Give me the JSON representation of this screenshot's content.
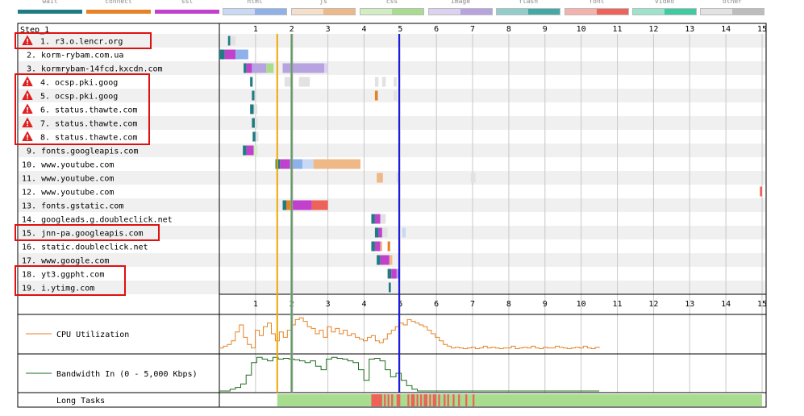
{
  "step_label": "Step_1",
  "legend": [
    {
      "label": "wait",
      "color": "#1f7c83",
      "style": "solid"
    },
    {
      "label": "connect",
      "color": "#e58226",
      "style": "solid"
    },
    {
      "label": "ssl",
      "color": "#c141cd",
      "style": "solid"
    },
    {
      "label": "html",
      "colors": [
        "#c9d9f3",
        "#8fb1ea"
      ]
    },
    {
      "label": "js",
      "colors": [
        "#f5dfca",
        "#efb887"
      ]
    },
    {
      "label": "css",
      "colors": [
        "#d2ecc4",
        "#a8dc8e"
      ]
    },
    {
      "label": "image",
      "colors": [
        "#dcd1ee",
        "#b7a3e0"
      ]
    },
    {
      "label": "flash",
      "colors": [
        "#90cdcb",
        "#43a9a2"
      ]
    },
    {
      "label": "font",
      "colors": [
        "#f5b2ac",
        "#ed6259"
      ]
    },
    {
      "label": "video",
      "colors": [
        "#9ce3cb",
        "#3fcaa1"
      ]
    },
    {
      "label": "other",
      "colors": [
        "#e2e2e2",
        "#bdbdbd"
      ]
    }
  ],
  "time_scale": {
    "max": 15,
    "ticks": [
      "1",
      "2",
      "3",
      "4",
      "5",
      "6",
      "7",
      "8",
      "9",
      "10",
      "11",
      "12",
      "13",
      "14",
      "15"
    ]
  },
  "markers": {
    "start_render": 1.6,
    "dom_content_loaded": 2.0,
    "on_load": 4.97
  },
  "requests": [
    {
      "label": "1. r3.o.lencr.org",
      "warning": true,
      "highlighted": true,
      "segments": [
        {
          "start": 0.24,
          "end": 0.3,
          "color": "#1f7c83"
        },
        {
          "start": 0.3,
          "end": 0.45,
          "color": "#e2e2e2"
        }
      ]
    },
    {
      "label": "2. korm-rybam.com.ua",
      "warning": false,
      "highlighted": false,
      "segments": [
        {
          "start": 0.0,
          "end": 0.15,
          "color": "#1f7c83"
        },
        {
          "start": 0.15,
          "end": 0.45,
          "color": "#c141cd"
        },
        {
          "start": 0.45,
          "end": 0.8,
          "color": "#8fb1ea"
        }
      ]
    },
    {
      "label": "3. kormrybam-14fcd.kxcdn.com",
      "warning": false,
      "highlighted": false,
      "segments": [
        {
          "start": 0.67,
          "end": 0.75,
          "color": "#1f7c83"
        },
        {
          "start": 0.75,
          "end": 0.9,
          "color": "#c141cd"
        },
        {
          "start": 0.9,
          "end": 1.3,
          "color": "#b7a3e0"
        },
        {
          "start": 1.3,
          "end": 1.5,
          "color": "#a8dc8e"
        },
        {
          "start": 1.75,
          "end": 2.9,
          "color": "#b7a3e0"
        },
        {
          "start": 2.9,
          "end": 3.0,
          "color": "#dcd1ee"
        }
      ]
    },
    {
      "label": "4. ocsp.pki.goog",
      "warning": true,
      "highlighted": true,
      "segments": [
        {
          "start": 0.85,
          "end": 0.92,
          "color": "#1f7c83"
        },
        {
          "start": 1.8,
          "end": 2.0,
          "color": "#e2e2e2"
        },
        {
          "start": 2.2,
          "end": 2.5,
          "color": "#e2e2e2"
        },
        {
          "start": 4.3,
          "end": 4.4,
          "color": "#e2e2e2"
        },
        {
          "start": 4.5,
          "end": 4.6,
          "color": "#e2e2e2"
        },
        {
          "start": 4.82,
          "end": 4.9,
          "color": "#e2e2e2"
        }
      ]
    },
    {
      "label": "5. ocsp.pki.goog",
      "warning": true,
      "highlighted": true,
      "segments": [
        {
          "start": 0.9,
          "end": 0.97,
          "color": "#1f7c83"
        },
        {
          "start": 4.3,
          "end": 4.38,
          "color": "#e58226"
        },
        {
          "start": 4.82,
          "end": 4.9,
          "color": "#e2e2e2"
        }
      ]
    },
    {
      "label": "6. status.thawte.com",
      "warning": true,
      "highlighted": true,
      "segments": [
        {
          "start": 0.85,
          "end": 0.95,
          "color": "#1f7c83"
        },
        {
          "start": 0.95,
          "end": 1.05,
          "color": "#e2e2e2"
        }
      ]
    },
    {
      "label": "7. status.thawte.com",
      "warning": true,
      "highlighted": true,
      "segments": [
        {
          "start": 0.9,
          "end": 0.98,
          "color": "#1f7c83"
        },
        {
          "start": 0.98,
          "end": 1.06,
          "color": "#e2e2e2"
        }
      ]
    },
    {
      "label": "8. status.thawte.com",
      "warning": true,
      "highlighted": true,
      "segments": [
        {
          "start": 0.92,
          "end": 1.0,
          "color": "#1f7c83"
        },
        {
          "start": 1.0,
          "end": 1.08,
          "color": "#e2e2e2"
        }
      ]
    },
    {
      "label": "9. fonts.googleapis.com",
      "warning": false,
      "highlighted": false,
      "segments": [
        {
          "start": 0.65,
          "end": 0.75,
          "color": "#1f7c83"
        },
        {
          "start": 0.75,
          "end": 0.95,
          "color": "#c141cd"
        },
        {
          "start": 0.95,
          "end": 1.05,
          "color": "#d2ecc4"
        }
      ]
    },
    {
      "label": "10. www.youtube.com",
      "warning": false,
      "highlighted": false,
      "segments": [
        {
          "start": 1.55,
          "end": 1.68,
          "color": "#1f7c83"
        },
        {
          "start": 1.68,
          "end": 1.95,
          "color": "#c141cd"
        },
        {
          "start": 1.95,
          "end": 2.3,
          "color": "#8fb1ea"
        },
        {
          "start": 2.3,
          "end": 2.6,
          "color": "#c9d9f3"
        },
        {
          "start": 2.6,
          "end": 3.9,
          "color": "#efb887"
        }
      ]
    },
    {
      "label": "11. www.youtube.com",
      "warning": false,
      "highlighted": false,
      "segments": [
        {
          "start": 4.35,
          "end": 4.52,
          "color": "#efb887"
        },
        {
          "start": 4.9,
          "end": 4.96,
          "color": "#e2e2e2"
        },
        {
          "start": 6.95,
          "end": 7.08,
          "color": "#e2e2e2"
        }
      ]
    },
    {
      "label": "12. www.youtube.com",
      "warning": false,
      "highlighted": false,
      "segments": [
        {
          "start": 14.94,
          "end": 15.0,
          "color": "#ed6259"
        }
      ]
    },
    {
      "label": "13. fonts.gstatic.com",
      "warning": false,
      "highlighted": false,
      "segments": [
        {
          "start": 1.75,
          "end": 1.85,
          "color": "#1f7c83"
        },
        {
          "start": 1.85,
          "end": 2.0,
          "color": "#e58226"
        },
        {
          "start": 2.0,
          "end": 2.55,
          "color": "#c141cd"
        },
        {
          "start": 2.55,
          "end": 3.0,
          "color": "#ed6259"
        }
      ]
    },
    {
      "label": "14. googleads.g.doubleclick.net",
      "warning": false,
      "highlighted": false,
      "segments": [
        {
          "start": 4.2,
          "end": 4.3,
          "color": "#1f7c83"
        },
        {
          "start": 4.3,
          "end": 4.45,
          "color": "#c141cd"
        },
        {
          "start": 4.45,
          "end": 4.6,
          "color": "#e2e2e2"
        }
      ]
    },
    {
      "label": "15. jnn-pa.googleapis.com",
      "warning": false,
      "highlighted": true,
      "segments": [
        {
          "start": 4.3,
          "end": 4.4,
          "color": "#1f7c83"
        },
        {
          "start": 4.4,
          "end": 4.5,
          "color": "#c141cd"
        },
        {
          "start": 4.5,
          "end": 4.65,
          "color": "#e2e2e2"
        },
        {
          "start": 5.05,
          "end": 5.15,
          "color": "#c9d9f3"
        }
      ]
    },
    {
      "label": "16. static.doubleclick.net",
      "warning": false,
      "highlighted": false,
      "segments": [
        {
          "start": 4.2,
          "end": 4.3,
          "color": "#1f7c83"
        },
        {
          "start": 4.3,
          "end": 4.45,
          "color": "#c141cd"
        },
        {
          "start": 4.45,
          "end": 4.5,
          "color": "#efb887"
        },
        {
          "start": 4.65,
          "end": 4.72,
          "color": "#e58226"
        },
        {
          "start": 4.95,
          "end": 5.0,
          "color": "#efb887"
        }
      ]
    },
    {
      "label": "17. www.google.com",
      "warning": false,
      "highlighted": false,
      "segments": [
        {
          "start": 4.35,
          "end": 4.45,
          "color": "#1f7c83"
        },
        {
          "start": 4.45,
          "end": 4.7,
          "color": "#c141cd"
        },
        {
          "start": 4.7,
          "end": 4.78,
          "color": "#efb887"
        }
      ]
    },
    {
      "label": "18. yt3.ggpht.com",
      "warning": false,
      "highlighted": true,
      "segments": [
        {
          "start": 4.65,
          "end": 4.75,
          "color": "#1f7c83"
        },
        {
          "start": 4.75,
          "end": 4.9,
          "color": "#c141cd"
        },
        {
          "start": 4.9,
          "end": 4.95,
          "color": "#b7a3e0"
        }
      ]
    },
    {
      "label": "19. i.ytimg.com",
      "warning": false,
      "highlighted": true,
      "segments": [
        {
          "start": 4.68,
          "end": 4.74,
          "color": "#1f7c83"
        }
      ]
    }
  ],
  "cpu": {
    "label": "CPU Utilization",
    "color": "#e58226",
    "values": [
      10,
      15,
      20,
      30,
      55,
      75,
      40,
      20,
      10,
      60,
      45,
      70,
      80,
      50,
      30,
      55,
      40,
      60,
      75,
      90,
      95,
      85,
      70,
      65,
      50,
      60,
      40,
      70,
      55,
      65,
      50,
      60,
      45,
      50,
      40,
      35,
      30,
      40,
      45,
      30,
      25,
      35,
      50,
      60,
      70,
      80,
      75,
      90,
      85,
      80,
      75,
      70,
      60,
      50,
      40,
      30,
      20,
      15,
      10,
      12,
      10,
      8,
      10,
      12,
      8,
      10,
      15,
      10,
      12,
      10,
      8,
      10,
      10,
      15,
      8,
      10,
      12,
      10,
      15,
      10,
      8,
      12,
      10,
      10,
      15,
      12,
      10,
      8,
      10,
      12,
      10,
      15,
      10,
      8,
      12,
      10
    ]
  },
  "bandwidth": {
    "label": "Bandwidth In (0 - 5,000 Kbps)",
    "color": "#1e6b1e",
    "values": [
      0,
      0,
      5,
      10,
      20,
      45,
      80,
      95,
      90,
      85,
      95,
      90,
      92,
      90,
      88,
      85,
      80,
      85,
      70,
      60,
      90,
      95,
      92,
      90,
      85,
      80,
      60,
      30,
      90,
      92,
      85,
      60,
      40,
      50,
      30,
      15,
      5,
      0,
      0,
      0,
      0,
      0,
      0,
      0,
      0,
      0,
      0,
      0,
      0,
      0,
      0,
      0,
      0,
      0,
      0,
      0,
      0,
      0,
      0,
      0,
      0,
      0,
      0,
      0,
      0,
      0,
      0,
      0,
      0,
      0,
      0,
      0
    ]
  },
  "long_tasks": {
    "label": "Long Tasks",
    "idle_color": "#a8dc8e",
    "busy_color": "#ed6259",
    "idle_range": [
      1.6,
      15.0
    ],
    "busy": [
      [
        4.2,
        4.5
      ],
      [
        4.55,
        4.6
      ],
      [
        4.65,
        4.7
      ],
      [
        4.75,
        4.8
      ],
      [
        4.9,
        5.0
      ],
      [
        5.2,
        5.25
      ],
      [
        5.3,
        5.4
      ],
      [
        5.45,
        5.5
      ],
      [
        5.55,
        5.6
      ],
      [
        5.65,
        5.75
      ],
      [
        5.8,
        5.85
      ],
      [
        5.9,
        6.0
      ],
      [
        6.05,
        6.1
      ],
      [
        6.2,
        6.25
      ],
      [
        6.3,
        6.35
      ],
      [
        6.45,
        6.5
      ],
      [
        6.6,
        6.65
      ],
      [
        6.8,
        6.85
      ],
      [
        7.0,
        7.05
      ]
    ]
  }
}
